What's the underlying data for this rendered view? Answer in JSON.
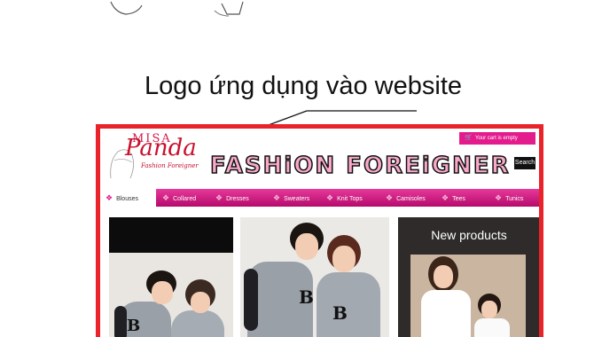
{
  "annotation": {
    "caption": "Logo ứng dụng vào website"
  },
  "website": {
    "logo": {
      "top_text": "MISA",
      "main_text": "Panda",
      "tagline": "Fashion Foreigner"
    },
    "cart_text": "Your cart is empty",
    "search_label": "Search",
    "brand_title": "FASHiON FOREiGNER",
    "nav": [
      "Blouses",
      "Collared",
      "Dresses",
      "Sweaters",
      "Knit Tops",
      "Camisoles",
      "Tees",
      "Tunics"
    ],
    "new_products_title": "New products"
  },
  "colors": {
    "frame": "#e8242a",
    "nav": "#d4187f",
    "brand_fill": "#f9a8c9"
  },
  "icons": [
    "cart-icon",
    "bow-icon"
  ]
}
